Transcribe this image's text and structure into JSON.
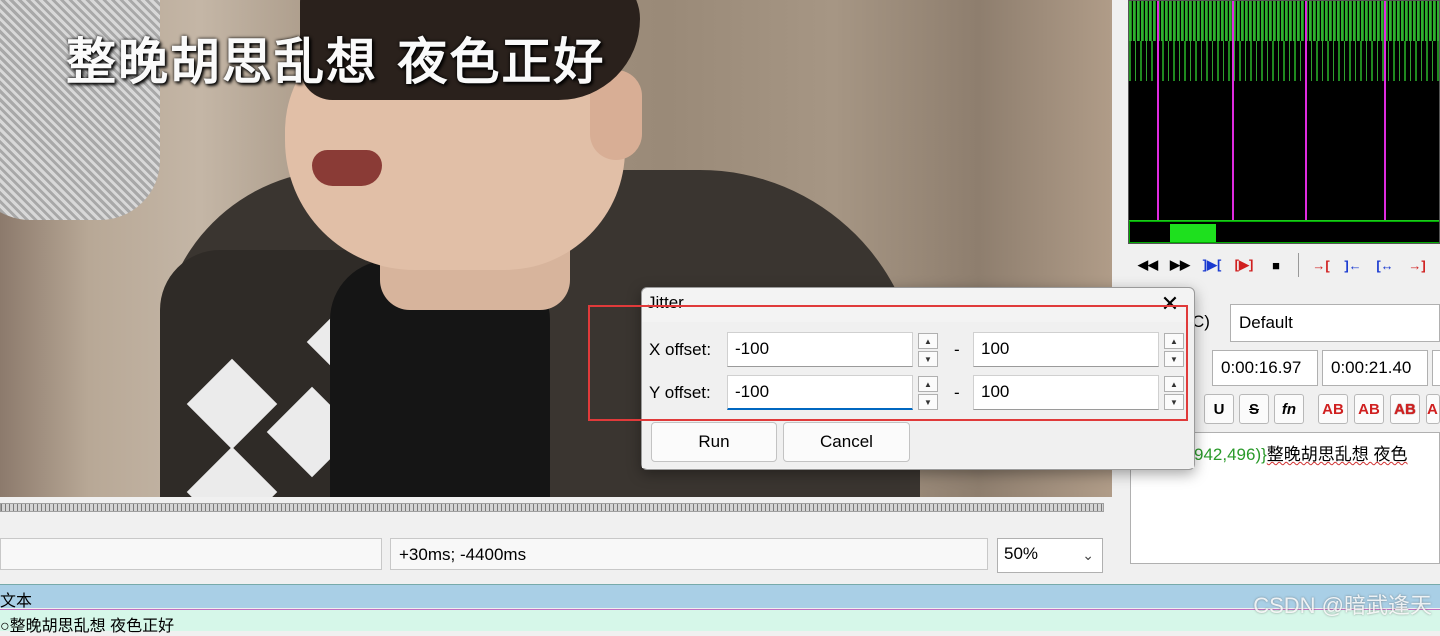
{
  "video": {
    "subtitle": "整晚胡思乱想 夜色正好"
  },
  "video_controls": {
    "time_offset": "+30ms; -4400ms",
    "zoom": "50%"
  },
  "subtitle_editor": {
    "style_label_suffix": "C)",
    "style": "Default",
    "start_time": "0:00:16.97",
    "end_time": "0:00:21.40",
    "format_buttons": [
      "U",
      "S",
      "fn",
      "AB",
      "AB",
      "AB",
      "A"
    ],
    "edit_tag": "942,496)}",
    "edit_text": "整晚胡思乱想 夜色"
  },
  "grid": {
    "header_text": "文本",
    "row_text": "整晚胡思乱想 夜色正好"
  },
  "dialog": {
    "title": "Jitter",
    "x_label": "X offset:",
    "x_min": "-100",
    "x_max": "100",
    "y_label": "Y offset:",
    "y_min": "-100",
    "y_max": "100",
    "separator": "-",
    "run_label": "Run",
    "cancel_label": "Cancel"
  },
  "watermark": "CSDN @暗武逢天",
  "icons": {
    "close": "close-icon",
    "spin_up": "spin-up-icon",
    "spin_down": "spin-down-icon",
    "zoom_dropdown": "chevron-down-icon"
  },
  "colors": {
    "highlight": "#e03a3a",
    "waveform": "#2fb02f",
    "marker": "#e02be0",
    "grid_header": "#a9cfe6",
    "grid_row": "#d6f7e9",
    "focus": "#0067c0"
  }
}
